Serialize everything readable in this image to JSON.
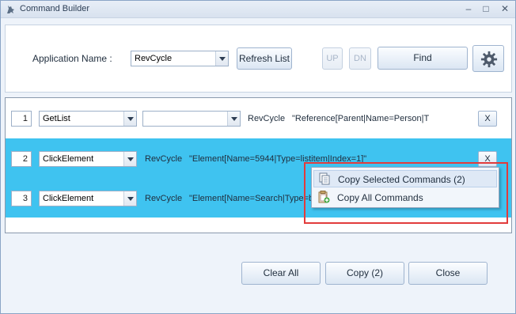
{
  "window": {
    "title": "Command Builder"
  },
  "top": {
    "application_label": "Application Name :",
    "application_value": "RevCycle",
    "refresh_label": "Refresh List",
    "up_label": "UP",
    "dn_label": "DN",
    "find_label": "Find"
  },
  "rows": [
    {
      "index": "1",
      "command": "GetList",
      "second_value": "",
      "app": "RevCycle",
      "target": "\"Reference[Parent|Name=Person|T",
      "remove_label": "X",
      "selected": false
    },
    {
      "index": "2",
      "command": "ClickElement",
      "app": "RevCycle",
      "target": "\"Element[Name=5944|Type=listitem|Index=1]\"",
      "remove_label": "X",
      "selected": true
    },
    {
      "index": "3",
      "command": "ClickElement",
      "app": "RevCycle",
      "target": "\"Element[Name=Search|Type=b",
      "selected": true
    }
  ],
  "bottom": {
    "clear_label": "Clear All",
    "copy_label": "Copy (2)",
    "close_label": "Close"
  },
  "context_menu": {
    "items": [
      {
        "label": "Copy Selected Commands (2)",
        "icon": "copy-icon"
      },
      {
        "label": "Copy All Commands",
        "icon": "clipboard-add-icon"
      }
    ]
  },
  "colors": {
    "selection": "#3fc3f0",
    "highlight_border": "#e23b3b"
  }
}
